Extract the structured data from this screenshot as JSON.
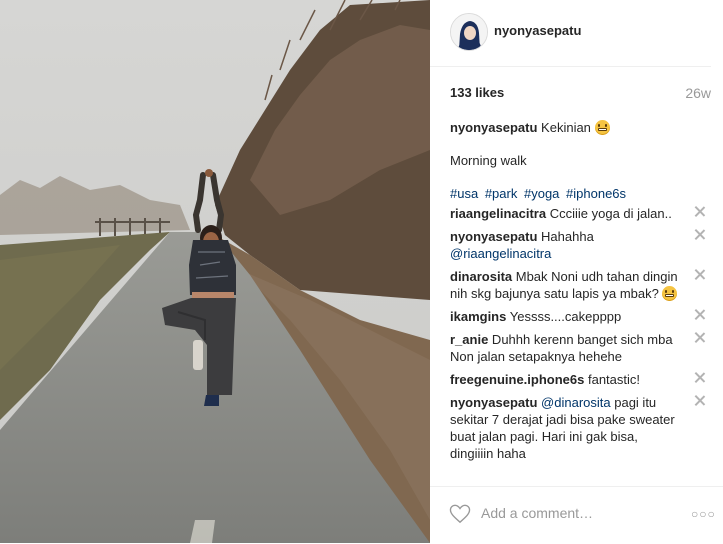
{
  "post": {
    "username": "nyonyasepatu",
    "likes": "133 likes",
    "age": "26w",
    "caption_user": "nyonyasepatu",
    "caption_text": "Kekinian",
    "caption_line2": "Morning walk",
    "hashtags": [
      "#usa",
      "#park",
      "#yoga",
      "#iphone6s"
    ]
  },
  "comments": [
    {
      "user": "riaangelinacitra",
      "text": " Ccciiie yoga di jalan..",
      "mention": "",
      "tail": ""
    },
    {
      "user": "nyonyasepatu",
      "text": " Hahahha ",
      "mention": "@riaangelinacitra",
      "tail": ""
    },
    {
      "user": "dinarosita",
      "text": " Mbak Noni udh tahan dingin nih skg bajunya satu lapis ya mbak?",
      "mention": "",
      "tail": ""
    },
    {
      "user": "ikamgins",
      "text": " Yessss....cakepppp",
      "mention": "",
      "tail": ""
    },
    {
      "user": "r_anie",
      "text": " Duhhh kerenn banget sich mba Non jalan setapaknya hehehe",
      "mention": "",
      "tail": ""
    },
    {
      "user": "freegenuine.iphone6s",
      "text": " fantastic!",
      "mention": "",
      "tail": ""
    },
    {
      "user": "nyonyasepatu",
      "text": " ",
      "mention": "@dinarosita",
      "tail": " pagi itu sekitar 7 derajat jadi bisa pake sweater buat jalan pagi. Hari ini gak bisa, dingiiiin haha"
    }
  ],
  "footer": {
    "placeholder": "Add a comment…",
    "more": "○○○"
  },
  "icons": {
    "heart": "heart-icon",
    "remove": "close-icon",
    "emoji": "grinning-emoji-icon",
    "more": "more-options-icon"
  },
  "colors": {
    "link": "#003569",
    "muted": "#999999",
    "border": "#efefef"
  }
}
